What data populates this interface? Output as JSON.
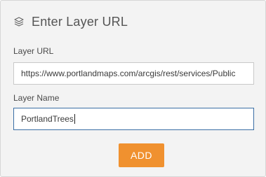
{
  "dialog": {
    "title": "Enter Layer URL",
    "title_icon": "layers-icon"
  },
  "layer_url": {
    "label": "Layer URL",
    "value": "https://www.portlandmaps.com/arcgis/rest/services/Public"
  },
  "layer_name": {
    "label": "Layer Name",
    "value": "PortlandTrees"
  },
  "actions": {
    "add_label": "ADD"
  },
  "colors": {
    "accent": "#f0912f",
    "focus_border": "#3a6ea5",
    "panel_bg": "#f3f3f3"
  }
}
